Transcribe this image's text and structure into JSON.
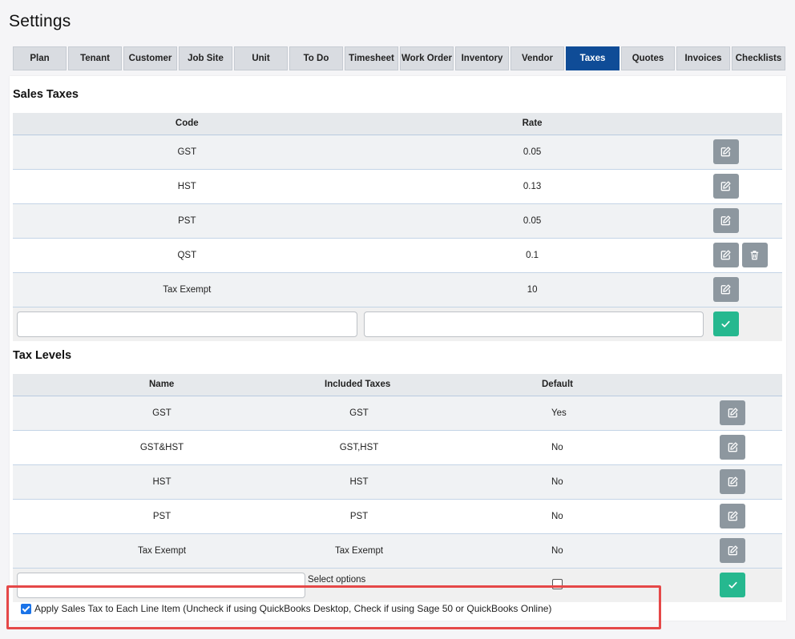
{
  "page_title": "Settings",
  "tabs": [
    {
      "label": "Plan",
      "active": false
    },
    {
      "label": "Tenant",
      "active": false
    },
    {
      "label": "Customer",
      "active": false
    },
    {
      "label": "Job Site",
      "active": false
    },
    {
      "label": "Unit",
      "active": false
    },
    {
      "label": "To Do",
      "active": false
    },
    {
      "label": "Timesheet",
      "active": false
    },
    {
      "label": "Work Order",
      "active": false
    },
    {
      "label": "Inventory",
      "active": false
    },
    {
      "label": "Vendor",
      "active": false
    },
    {
      "label": "Taxes",
      "active": true
    },
    {
      "label": "Quotes",
      "active": false
    },
    {
      "label": "Invoices",
      "active": false
    },
    {
      "label": "Checklists",
      "active": false
    }
  ],
  "sales_taxes": {
    "title": "Sales Taxes",
    "headers": {
      "code": "Code",
      "rate": "Rate"
    },
    "rows": [
      {
        "code": "GST",
        "rate": "0.05",
        "deletable": false
      },
      {
        "code": "HST",
        "rate": "0.13",
        "deletable": false
      },
      {
        "code": "PST",
        "rate": "0.05",
        "deletable": false
      },
      {
        "code": "QST",
        "rate": "0.1",
        "deletable": true
      },
      {
        "code": "Tax Exempt",
        "rate": "10",
        "deletable": false
      }
    ],
    "new_code_value": "",
    "new_rate_value": ""
  },
  "tax_levels": {
    "title": "Tax Levels",
    "headers": {
      "name": "Name",
      "included": "Included Taxes",
      "default": "Default"
    },
    "rows": [
      {
        "name": "GST",
        "included": "GST",
        "default": "Yes"
      },
      {
        "name": "GST&HST",
        "included": "GST,HST",
        "default": "No"
      },
      {
        "name": "HST",
        "included": "HST",
        "default": "No"
      },
      {
        "name": "PST",
        "included": "PST",
        "default": "No"
      },
      {
        "name": "Tax Exempt",
        "included": "Tax Exempt",
        "default": "No"
      }
    ],
    "new_name_value": "",
    "select_placeholder": "Select options",
    "new_default_checked": false
  },
  "apply_tax_option": {
    "label": "Apply Sales Tax to Each Line Item (Uncheck if using QuickBooks Desktop, Check if using Sage 50 or QuickBooks Online)",
    "checked": true
  },
  "colors": {
    "active_tab": "#0f4c97",
    "edit_button": "#8d979f",
    "confirm_button": "#26b88f",
    "highlight": "#e54848"
  }
}
